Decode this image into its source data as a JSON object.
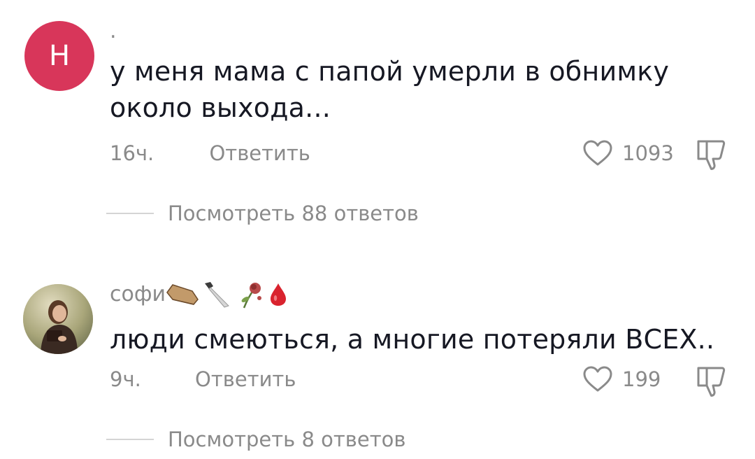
{
  "comments": [
    {
      "avatar_letter": "H",
      "avatar_color": "#d8365a",
      "username": ".",
      "text": "у меня мама с папой умерли в обнимку около выхода...",
      "time": "16ч.",
      "reply_label": "Ответить",
      "likes": "1093",
      "view_replies": "Посмотреть 88 ответов"
    },
    {
      "avatar_image": "woman-reading-book-photo",
      "username": "софи",
      "username_emojis": [
        "coffin-emoji",
        "knife-emoji",
        "wilted-rose-emoji",
        "drop-of-blood-emoji"
      ],
      "text": "люди смеються, а многие потеряли ВСЕХ..",
      "time": "9ч.",
      "reply_label": "Ответить",
      "likes": "199",
      "view_replies": "Посмотреть 8 ответов"
    }
  ],
  "icons": {
    "like": "heart-outline-icon",
    "dislike": "thumbs-down-outline-icon"
  }
}
